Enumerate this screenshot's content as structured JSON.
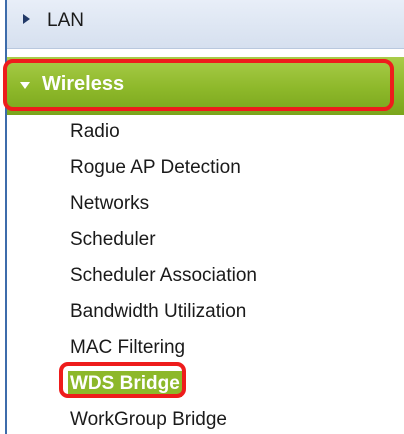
{
  "nav": {
    "lan": {
      "label": "LAN",
      "icon": "triangle-right-icon"
    },
    "wireless": {
      "label": "Wireless",
      "icon": "triangle-down-icon",
      "expanded": true,
      "items": [
        {
          "label": "Radio"
        },
        {
          "label": "Rogue AP Detection"
        },
        {
          "label": "Networks"
        },
        {
          "label": "Scheduler"
        },
        {
          "label": "Scheduler Association"
        },
        {
          "label": "Bandwidth Utilization"
        },
        {
          "label": "MAC Filtering"
        },
        {
          "label": "WDS Bridge",
          "selected": true
        },
        {
          "label": "WorkGroup Bridge"
        }
      ]
    }
  },
  "colors": {
    "menu_green": "#8db82a",
    "highlight_red": "#ee1c1c",
    "lan_background": "#dde5f2",
    "nav_border_blue": "#3d6cab"
  }
}
